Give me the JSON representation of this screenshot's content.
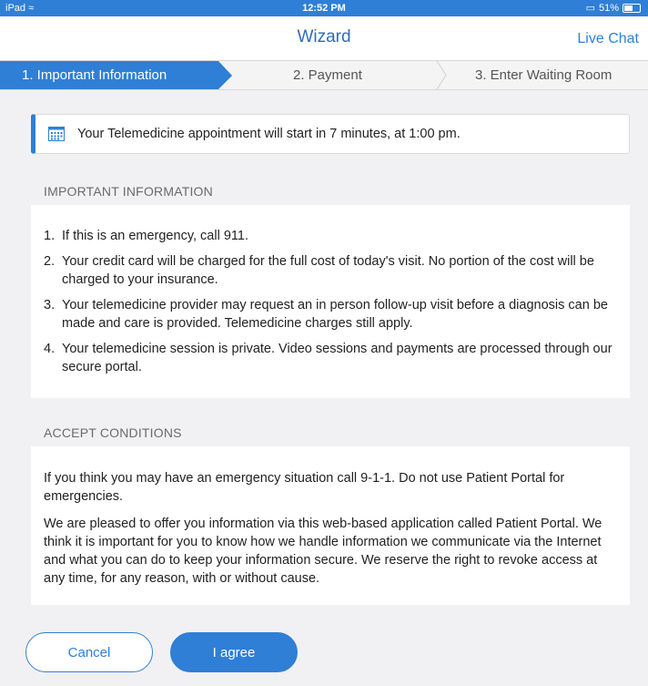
{
  "status_bar": {
    "device": "iPad",
    "time": "12:52 PM",
    "battery": "51%"
  },
  "nav": {
    "title": "Wizard",
    "live_chat": "Live Chat"
  },
  "steps": [
    {
      "label": "1. Important Information",
      "active": true
    },
    {
      "label": "2. Payment",
      "active": false
    },
    {
      "label": "3. Enter Waiting Room",
      "active": false
    }
  ],
  "notice": {
    "text": "Your Telemedicine appointment will start in 7 minutes, at 1:00 pm."
  },
  "important": {
    "heading": "IMPORTANT INFORMATION",
    "items": [
      {
        "num": "1.",
        "text": "If this is an emergency, call 911."
      },
      {
        "num": "2.",
        "text": "Your credit card will be charged for the full cost of today's visit. No portion of the cost will be charged to your insurance."
      },
      {
        "num": "3.",
        "text": "Your telemedicine provider may request an in person follow-up visit before a diagnosis can be made and care is provided. Telemedicine charges still apply."
      },
      {
        "num": "4.",
        "text": "Your telemedicine session is private. Video sessions and payments are processed through our secure portal."
      }
    ]
  },
  "accept": {
    "heading": "ACCEPT CONDITIONS",
    "paragraphs": [
      "If you think you may have an emergency situation call 9-1-1. Do not use Patient Portal for emergencies.",
      "We are pleased to offer you information via this web-based application called Patient Portal. We think it is important for you to know how we handle information we communicate via the Internet and what you can do to keep your information secure. We reserve the right to revoke access at any time, for any reason, with or without cause."
    ]
  },
  "buttons": {
    "cancel": "Cancel",
    "agree": "I agree"
  },
  "colors": {
    "accent": "#2f7fd6",
    "background": "#f1f1f3"
  },
  "icons": {
    "notice": "calendar-icon",
    "wifi": "wifi-icon",
    "battery": "battery-icon",
    "screen": "screen-mirror-icon"
  }
}
